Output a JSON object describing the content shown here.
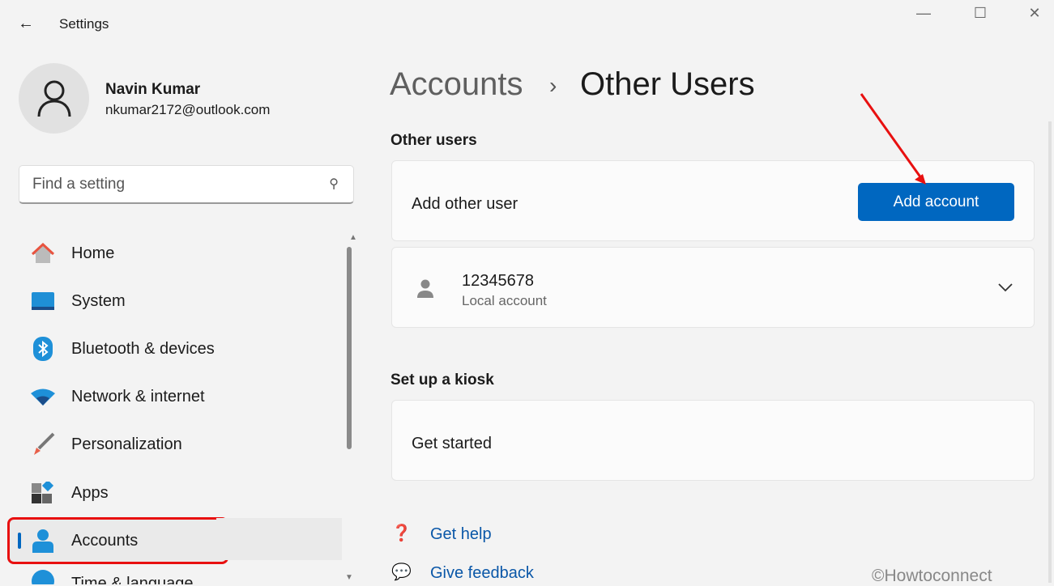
{
  "window": {
    "title": "Settings",
    "back": "←",
    "minimize": "—",
    "maximize": "☐",
    "close": "✕"
  },
  "user": {
    "name": "Navin Kumar",
    "email": "nkumar2172@outlook.com"
  },
  "search": {
    "placeholder": "Find a setting"
  },
  "nav": [
    {
      "label": "Home",
      "icon": "home-icon"
    },
    {
      "label": "System",
      "icon": "system-icon"
    },
    {
      "label": "Bluetooth & devices",
      "icon": "bluetooth-icon"
    },
    {
      "label": "Network & internet",
      "icon": "wifi-icon"
    },
    {
      "label": "Personalization",
      "icon": "brush-icon"
    },
    {
      "label": "Apps",
      "icon": "apps-icon"
    },
    {
      "label": "Accounts",
      "icon": "accounts-icon",
      "selected": true
    },
    {
      "label": "Time & language",
      "icon": "globe-icon"
    }
  ],
  "breadcrumb": {
    "parent": "Accounts",
    "sep": "›",
    "current": "Other Users"
  },
  "other_users": {
    "heading": "Other users",
    "add_label": "Add other user",
    "add_button": "Add account",
    "account": {
      "name": "12345678",
      "type": "Local account"
    }
  },
  "kiosk": {
    "heading": "Set up a kiosk",
    "label": "Get started"
  },
  "links": {
    "help": "Get help",
    "feedback": "Give feedback"
  },
  "watermark": "©Howtoconnect",
  "accent": "#0067c0"
}
